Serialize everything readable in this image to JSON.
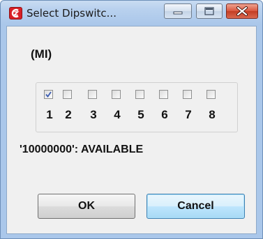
{
  "window": {
    "title": "Select Dipswitc...",
    "app_icon": "cz-logo-icon",
    "caption_buttons": [
      "minimize-icon",
      "maximize-icon",
      "close-icon"
    ],
    "accent_color": "#c9442c"
  },
  "dialog": {
    "mode_label": "(MI)",
    "switches": [
      {
        "number": "1",
        "checked": true
      },
      {
        "number": "2",
        "checked": false
      },
      {
        "number": "3",
        "checked": false
      },
      {
        "number": "4",
        "checked": false
      },
      {
        "number": "5",
        "checked": false
      },
      {
        "number": "6",
        "checked": false
      },
      {
        "number": "7",
        "checked": false
      },
      {
        "number": "8",
        "checked": false
      }
    ],
    "status": "'10000000': AVAILABLE",
    "ok_label": "OK",
    "cancel_label": "Cancel"
  }
}
